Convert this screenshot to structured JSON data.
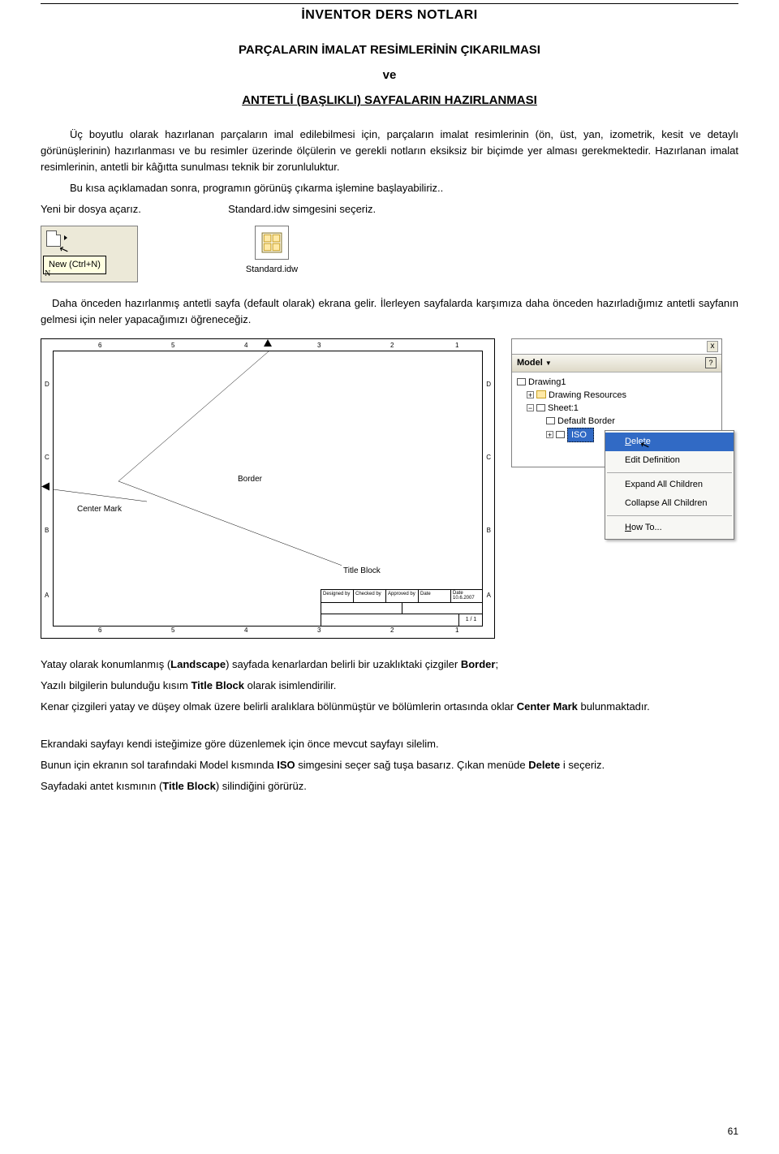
{
  "header": "İNVENTOR DERS NOTLARI",
  "title1": "PARÇALARIN İMALAT RESİMLERİNİN ÇIKARILMASI",
  "title2": "ve",
  "title3": "ANTETLİ (BAŞLIKLI) SAYFALARIN HAZIRLANMASI",
  "p1": "Üç boyutlu olarak hazırlanan parçaların imal edilebilmesi için, parçaların imalat resimlerinin (ön, üst, yan, izometrik, kesit ve detaylı görünüşlerinin) hazırlanması ve bu resimler üzerinde ölçülerin ve gerekli notların eksiksiz bir biçimde yer alması gerekmektedir. Hazırlanan imalat resimlerinin, antetli bir kâğıtta sunulması teknik bir zorunluluktur.",
  "p2": "Bu kısa açıklamadan sonra, programın görünüş çıkarma işlemine başlayabiliriz..",
  "p3a": "Yeni bir dosya açarız.",
  "p3b": "Standard.idw  simgesini seçeriz.",
  "newTooltip": "New (Ctrl+N)",
  "newLetter": "N",
  "stdLabel": "Standard.idw",
  "p4": "Daha önceden hazırlanmış antetli sayfa  (default olarak)  ekrana gelir.  İlerleyen sayfalarda karşımıza daha önceden hazırladığımız antetli sayfanın gelmesi için neler yapacağımızı öğreneceğiz.",
  "sheetLabels": {
    "border": "Border",
    "centerMark": "Center Mark",
    "titleBlock": "Title Block"
  },
  "titleBlockHead": [
    "Designed by",
    "Checked by",
    "Approved by",
    "Date",
    "Date\n10.6.2007"
  ],
  "titleBlockSheets": "1 / 1",
  "sheetRuler": {
    "topNums": [
      "6",
      "5",
      "4",
      "3",
      "2",
      "1"
    ],
    "sideLetters": [
      "D",
      "C",
      "B",
      "A"
    ]
  },
  "modelPanel": {
    "title": "Model",
    "helpIcon": "?",
    "closeIcon": "x",
    "tree": {
      "root": "Drawing1",
      "resources": "Drawing Resources",
      "sheet": "Sheet:1",
      "defaultBorder": "Default Border",
      "iso": "ISO"
    },
    "menu": {
      "delete": "Delete",
      "editDef": "Edit Definition",
      "expand": "Expand All Children",
      "collapse": "Collapse All Children",
      "howto": "How To..."
    }
  },
  "p5a": "Yatay olarak konumlanmış (",
  "p5a_bold": "Landscape",
  "p5a_after": ") sayfada kenarlardan belirli bir uzaklıktaki çizgiler ",
  "p5a_bold2": "Border",
  "p5a_end": ";",
  "p5b": "Yazılı bilgilerin bulunduğu kısım ",
  "p5b_bold": "Title Block",
  "p5b_end": " olarak isimlendirilir.",
  "p5c": "Kenar çizgileri yatay ve düşey olmak üzere belirli aralıklara bölünmüştür ve bölümlerin ortasında oklar ",
  "p5c_bold": "Center Mark",
  "p5c_end": " bulunmaktadır.",
  "p6": "Ekrandaki sayfayı kendi isteğimize göre düzenlemek için önce mevcut sayfayı silelim.",
  "p7a": "Bunun için ekranın sol tarafındaki Model kısmında ",
  "p7a_bold": "ISO",
  "p7a_mid": " simgesini seçer sağ tuşa basarız. Çıkan menüde ",
  "p7a_bold2": "Delete",
  "p7a_end": " i seçeriz.",
  "p8": "Sayfadaki antet kısmının (",
  "p8_bold": "Title Block",
  "p8_end": ") silindiğini görürüz.",
  "pageNum": "61"
}
